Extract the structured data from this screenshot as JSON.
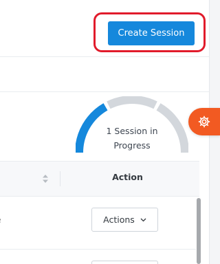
{
  "header": {
    "create_button_label": "Create Session"
  },
  "sessions_gauge": {
    "label_line1": "1 Session in",
    "label_line2": "Progress",
    "in_progress": 1,
    "segments": 3
  },
  "table": {
    "columns": [
      {
        "label": ""
      },
      {
        "label": "Action"
      }
    ],
    "rows": [
      {
        "name_fragment": "e",
        "action_label": "Actions"
      }
    ]
  },
  "colors": {
    "primary": "#1588dc",
    "gauge_active": "#1588dc",
    "gauge_inactive": "#d3d7dc",
    "settings_fab": "#f25a22",
    "highlight": "#e11b2b"
  },
  "icons": {
    "settings": "gear-icon",
    "sort": "sort-icon",
    "dropdown": "chevron-down-icon"
  }
}
